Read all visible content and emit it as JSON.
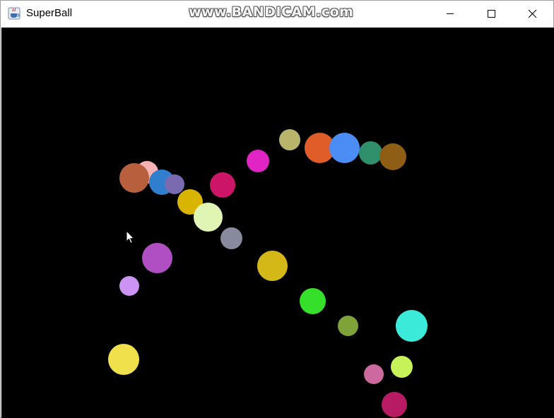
{
  "window": {
    "title": "SuperBall",
    "watermark": "www.BANDICAM.com"
  },
  "title_bar_buttons": {
    "minimize": "minimize-icon",
    "maximize": "maximize-icon",
    "close": "close-icon"
  },
  "balls": [
    {
      "color": "#f5b3b3"
    },
    {
      "color": "#b85f3d"
    },
    {
      "color": "#2f7fce"
    },
    {
      "color": "#7a6bb0"
    },
    {
      "color": "#d9b400"
    },
    {
      "color": "#e0f5b3"
    },
    {
      "color": "#cc1566"
    },
    {
      "color": "#8a8a9e"
    },
    {
      "color": "#e124c4"
    },
    {
      "color": "#b8b46c"
    },
    {
      "color": "#e05d2a"
    },
    {
      "color": "#4b8df5"
    },
    {
      "color": "#2e8f6a"
    },
    {
      "color": "#8f5e15"
    },
    {
      "color": "#b04ec4"
    },
    {
      "color": "#d4b818"
    },
    {
      "color": "#cd93f2"
    },
    {
      "color": "#36e02a"
    },
    {
      "color": "#7fa338"
    },
    {
      "color": "#3bead9"
    },
    {
      "color": "#f0e04c"
    },
    {
      "color": "#cc6aa0"
    },
    {
      "color": "#c8f25a"
    },
    {
      "color": "#b81a63"
    }
  ]
}
